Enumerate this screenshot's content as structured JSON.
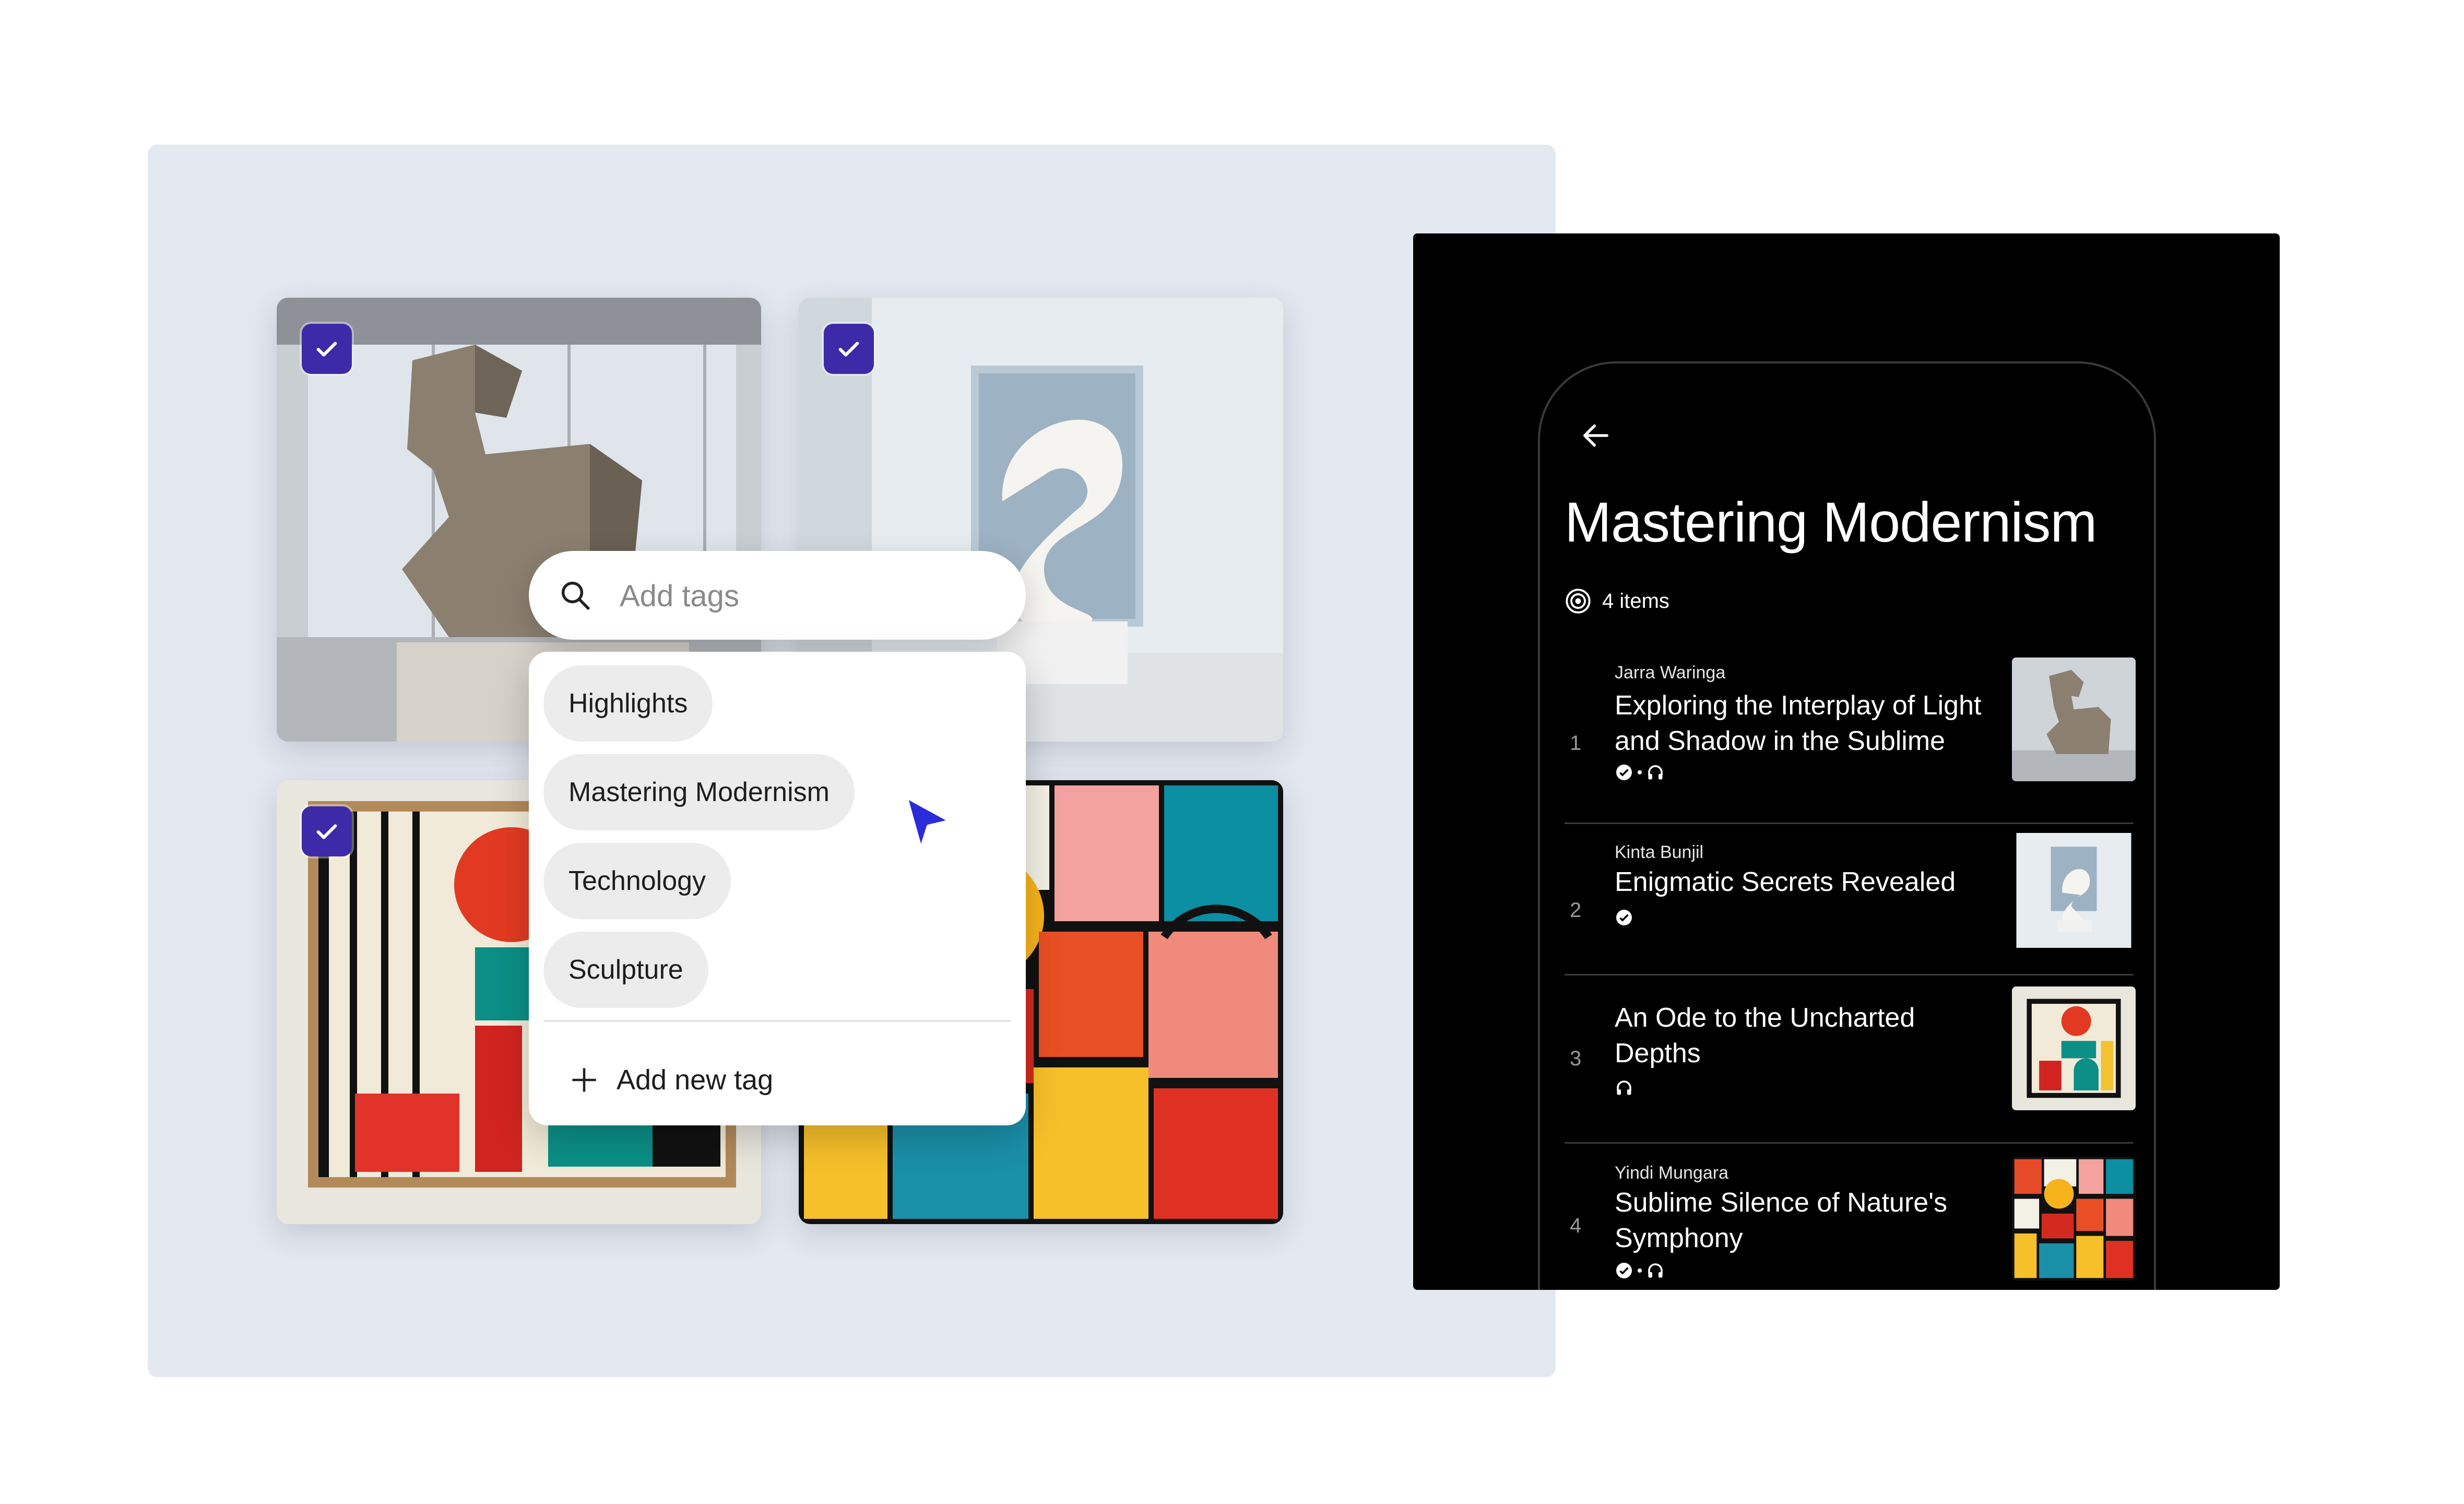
{
  "tag_picker": {
    "search_placeholder": "Add tags",
    "tags": [
      "Highlights",
      "Mastering Modernism",
      "Technology",
      "Sculpture"
    ],
    "add_new_label": "Add new tag"
  },
  "collection": {
    "title": "Mastering Modernism",
    "count_label": "4 items",
    "items": [
      {
        "number": "1",
        "author": "Jarra Waringa",
        "title": "Exploring the Interplay of Light and Shadow in the Sublime",
        "verified": true,
        "audio": true
      },
      {
        "number": "2",
        "author": "Kinta Bunjil",
        "title": "Enigmatic Secrets Revealed",
        "verified": true,
        "audio": false
      },
      {
        "number": "3",
        "author": "",
        "title": "An Ode to the Uncharted Depths",
        "verified": false,
        "audio": true
      },
      {
        "number": "4",
        "author": "Yindi Mungara",
        "title": "Sublime Silence of Nature's Symphony",
        "verified": true,
        "audio": true
      }
    ]
  },
  "colors": {
    "accent": "#3d2aa8",
    "cursor": "#2b2bd9",
    "panel_bg": "#e4e8f0"
  },
  "icons": [
    "check-icon",
    "search-icon",
    "plus-icon",
    "cursor-icon",
    "back-arrow-icon",
    "collection-icon",
    "verified-icon",
    "headphones-icon"
  ]
}
